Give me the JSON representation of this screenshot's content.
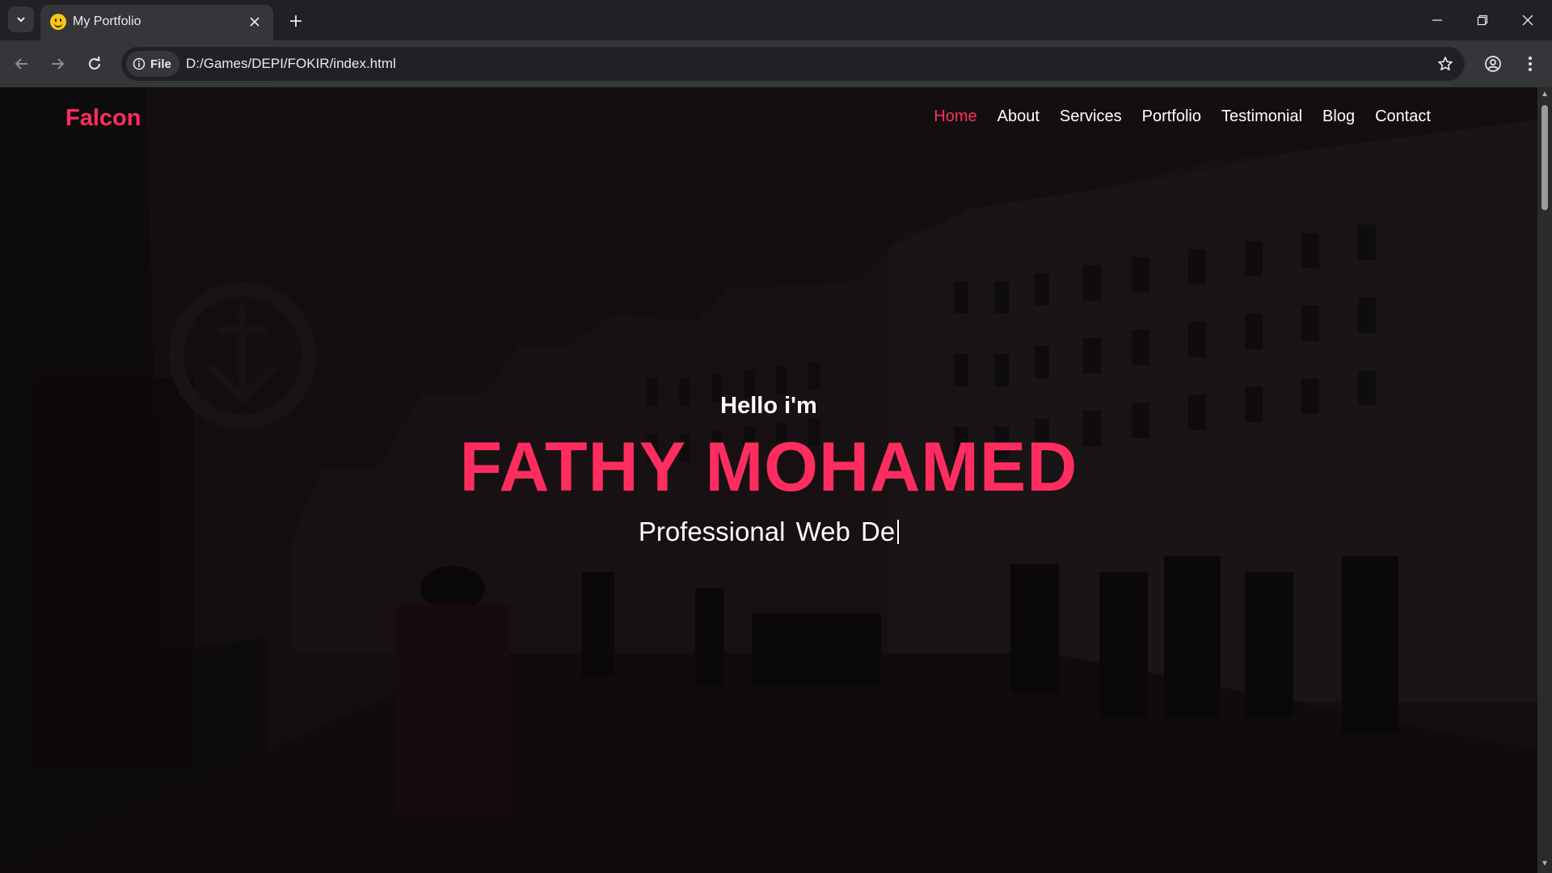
{
  "browser": {
    "tab_title": "My Portfolio",
    "url": "D:/Games/DEPI/FOKIR/index.html",
    "site_info_label": "File"
  },
  "page": {
    "logo": "Falcon",
    "nav": [
      {
        "label": "Home",
        "active": true
      },
      {
        "label": "About",
        "active": false
      },
      {
        "label": "Services",
        "active": false
      },
      {
        "label": "Portfolio",
        "active": false
      },
      {
        "label": "Testimonial",
        "active": false
      },
      {
        "label": "Blog",
        "active": false
      },
      {
        "label": "Contact",
        "active": false
      }
    ],
    "hero": {
      "greeting": "Hello i'm",
      "name": "FATHY MOHAMED",
      "typed_role": "Professional Web De"
    }
  },
  "colors": {
    "accent": "#ff2d5f",
    "chrome_dark": "#202124",
    "chrome_toolbar": "#35363a"
  }
}
